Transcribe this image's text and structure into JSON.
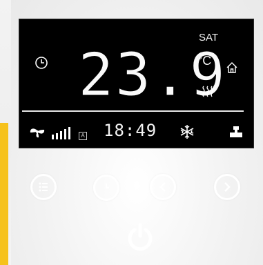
{
  "display": {
    "day": "SAT",
    "temperature": "23.9",
    "unit": "°C",
    "time": "18:49",
    "fan_mode_badge": "A"
  },
  "icons": {
    "clock": "clock-icon",
    "home": "home-icon",
    "heating": "heat-wave-icon",
    "fan": "fan-icon",
    "signal": "fan-speed-bars-icon",
    "snowflake": "snowflake-icon",
    "valve": "valve-icon"
  },
  "buttons": [
    "menu-button",
    "clock-button",
    "left-button",
    "right-button",
    "power-button"
  ],
  "colors": {
    "screen": "#000000",
    "digits": "#ffffff",
    "accent": "#f6c21c",
    "panel": "#f1f1f1"
  }
}
